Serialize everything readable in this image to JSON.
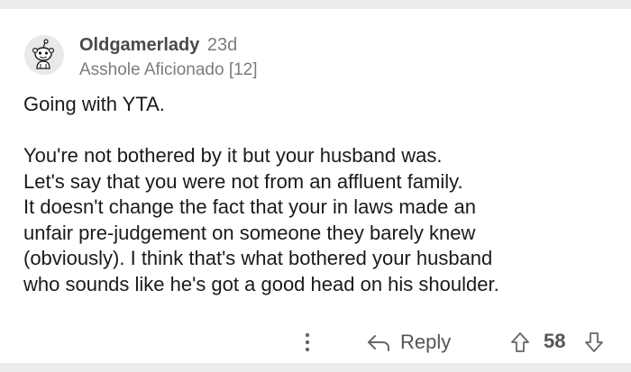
{
  "comment": {
    "username": "Oldgamerlady",
    "age": "23d",
    "flair": "Asshole Aficionado [12]",
    "body": "Going with YTA.\n\nYou're not bothered by it but your husband was.\nLet's say that you were not from an affluent family.\nIt doesn't change the fact that your in laws made an\nunfair pre-judgement on someone they barely knew\n(obviously).  I think that's what bothered your husband\nwho sounds like he's got a good head on his shoulder.",
    "reply_label": "Reply",
    "score": "58"
  },
  "icons": {
    "avatar": "snoo-avatar",
    "more": "more-vertical-icon",
    "reply": "reply-arrow-icon",
    "upvote": "upvote-arrow-icon",
    "downvote": "downvote-arrow-icon"
  }
}
